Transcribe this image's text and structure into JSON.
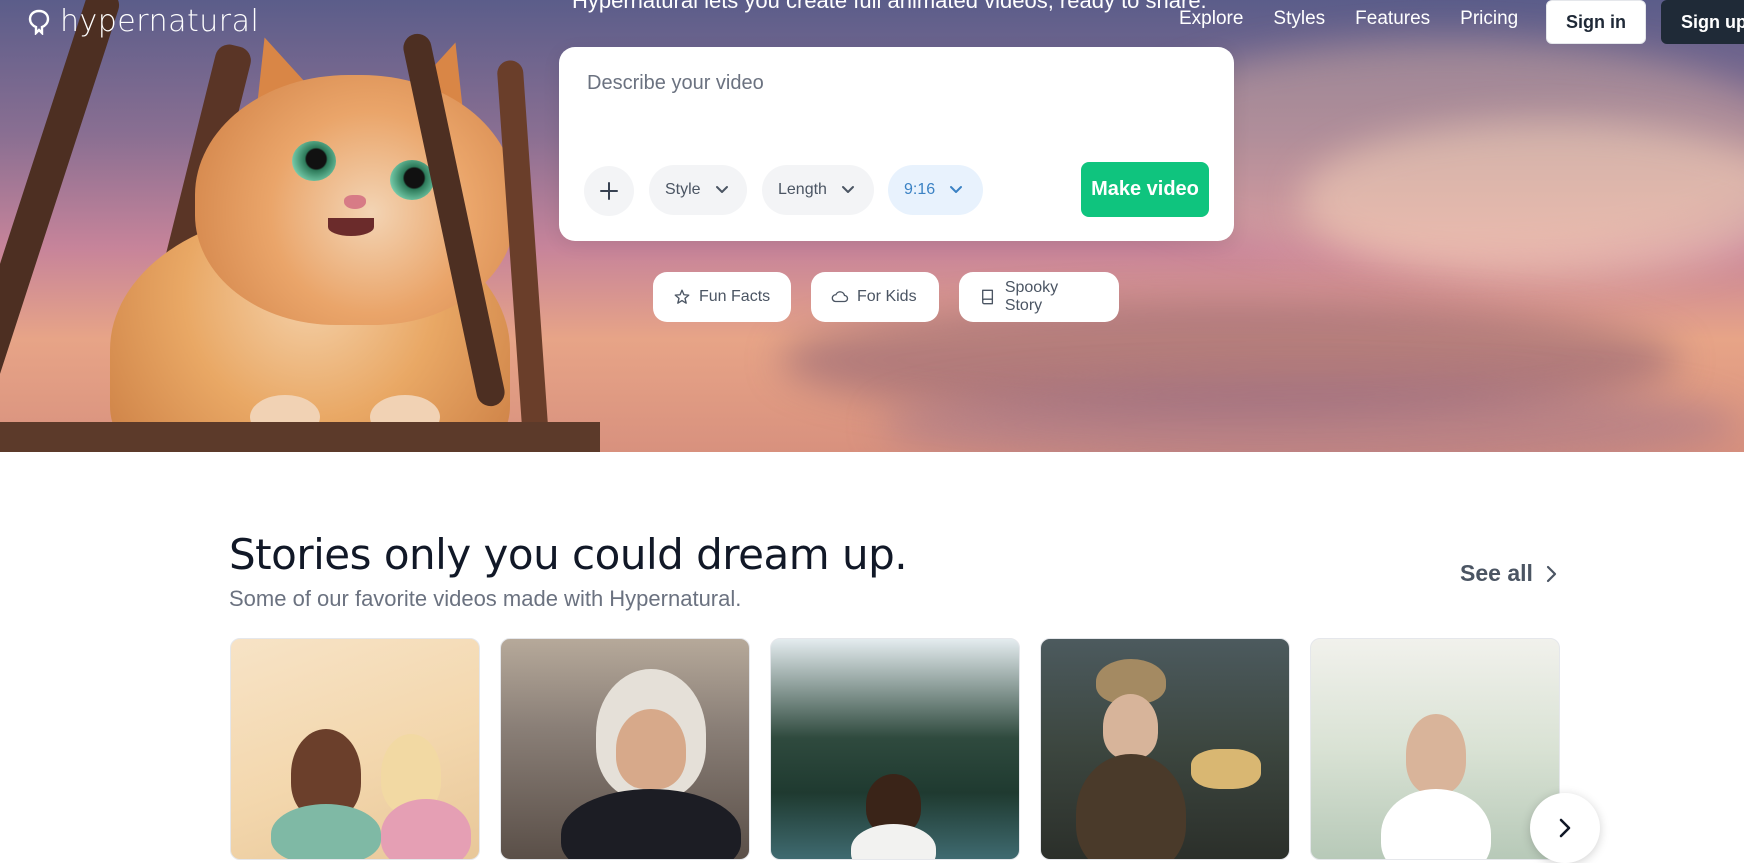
{
  "brand": {
    "name": "hypernatural"
  },
  "hero": {
    "tagline": "Hypernatural lets you create full animated videos, ready to share."
  },
  "nav": {
    "links": [
      "Explore",
      "Styles",
      "Features",
      "Pricing"
    ],
    "sign_in": "Sign in",
    "sign_up": "Sign up"
  },
  "prompt": {
    "placeholder": "Describe your video",
    "style_label": "Style",
    "length_label": "Length",
    "ratio_label": "9:16",
    "make_button": "Make video"
  },
  "suggestions": [
    {
      "label": "Fun Facts",
      "icon": "star-icon"
    },
    {
      "label": "For Kids",
      "icon": "cloud-icon"
    },
    {
      "label": "Spooky Story",
      "icon": "book-icon"
    }
  ],
  "stories": {
    "title": "Stories only you could dream up.",
    "subtitle": "Some of our favorite videos made with Hypernatural.",
    "see_all": "See all"
  },
  "colors": {
    "accent_green": "#0fc47e",
    "dark_button": "#1f2a37",
    "ratio_pill_text": "#3b82c4"
  }
}
